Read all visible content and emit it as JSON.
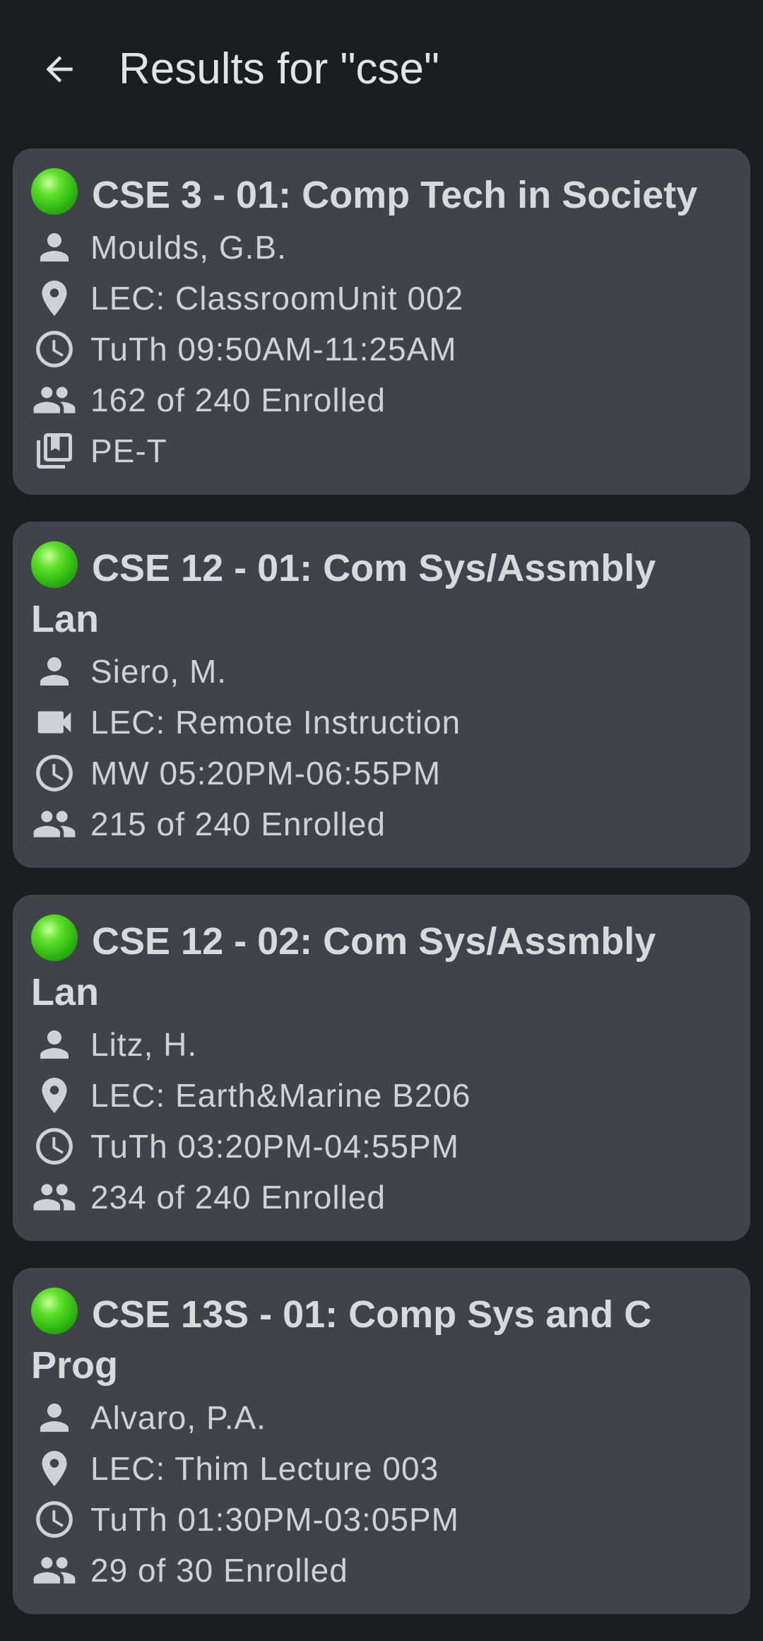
{
  "header": {
    "title": "Results for \"cse\"",
    "back_icon": "arrow-back-icon"
  },
  "colors": {
    "background": "#1c1d1f",
    "card": "#40434a",
    "status_open": "#3cc81a",
    "text": "#d0d2d6"
  },
  "courses": [
    {
      "title": "CSE 3 - 01: Comp Tech in Society",
      "status": "open",
      "instructor": "Moulds, G.B.",
      "location": "LEC: ClassroomUnit 002",
      "location_icon": "place-icon",
      "schedule": "TuTh 09:50AM-11:25AM",
      "enrollment": "162 of 240 Enrolled",
      "ge": "PE-T"
    },
    {
      "title": "CSE 12 - 01: Com Sys/Assmbly Lan",
      "status": "open",
      "instructor": "Siero, M.",
      "location": "LEC: Remote Instruction",
      "location_icon": "videocam-icon",
      "schedule": "MW 05:20PM-06:55PM",
      "enrollment": "215 of 240 Enrolled"
    },
    {
      "title": "CSE 12 - 02: Com Sys/Assmbly Lan",
      "status": "open",
      "instructor": "Litz, H.",
      "location": "LEC: Earth&Marine B206",
      "location_icon": "place-icon",
      "schedule": "TuTh 03:20PM-04:55PM",
      "enrollment": "234 of 240 Enrolled"
    },
    {
      "title": "CSE 13S - 01: Comp Sys and C Prog",
      "status": "open",
      "instructor": "Alvaro, P.A.",
      "location": "LEC: Thim Lecture 003",
      "location_icon": "place-icon",
      "schedule": "TuTh 01:30PM-03:05PM",
      "enrollment": "29 of 30 Enrolled"
    }
  ]
}
